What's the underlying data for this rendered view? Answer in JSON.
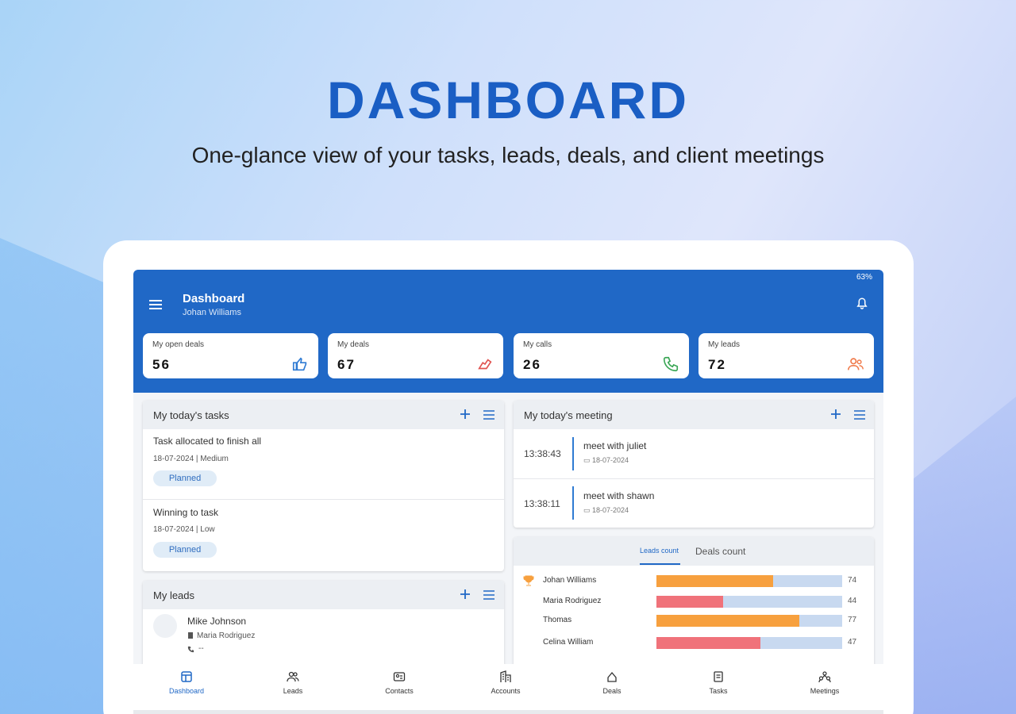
{
  "hero": {
    "title": "DASHBOARD",
    "subtitle": "One-glance view of your tasks, leads, deals, and client meetings"
  },
  "status_bar": {
    "battery": "63%"
  },
  "appbar": {
    "title": "Dashboard",
    "user": "Johan Williams"
  },
  "stats": [
    {
      "label": "My open deals",
      "value": "56",
      "icon": "thumbs-up-icon",
      "color": "#2f7bd3"
    },
    {
      "label": "My deals",
      "value": "67",
      "icon": "handshake-icon",
      "color": "#e0524f"
    },
    {
      "label": "My calls",
      "value": "26",
      "icon": "phone-icon",
      "color": "#3aa655"
    },
    {
      "label": "My leads",
      "value": "72",
      "icon": "users-icon",
      "color": "#f07a4a"
    }
  ],
  "tasks_panel": {
    "title": "My today's tasks",
    "tasks": [
      {
        "name": "Task allocated to finish all",
        "meta": "18-07-2024 | Medium",
        "status": "Planned"
      },
      {
        "name": "Winning to task",
        "meta": "18-07-2024 | Low",
        "status": "Planned"
      }
    ]
  },
  "meetings_panel": {
    "title": "My today's meeting",
    "meetings": [
      {
        "time": "13:38:43",
        "title": "meet with juliet",
        "date": "18-07-2024"
      },
      {
        "time": "13:38:11",
        "title": "meet with shawn",
        "date": "18-07-2024"
      }
    ]
  },
  "leads_panel": {
    "title": "My leads",
    "lead": {
      "name": "Mike Johnson",
      "owner": "Maria Rodriguez",
      "phone": "--"
    }
  },
  "counts_panel": {
    "tabs": [
      "Leads count",
      "Deals count"
    ],
    "active_tab": 0,
    "rows": [
      {
        "name": "Johan Williams",
        "value": 74,
        "fraction": 0.63,
        "color": "#f7a03e",
        "trophy": true
      },
      {
        "name": "Maria Rodriguez",
        "value": 44,
        "fraction": 0.36,
        "color": "#f0727a",
        "trophy": false
      },
      {
        "name": "Thomas",
        "value": 77,
        "fraction": 0.77,
        "color": "#f7a03e",
        "trophy": false
      },
      {
        "name": "Celina William",
        "value": 47,
        "fraction": 0.56,
        "color": "#f0727a",
        "trophy": false
      }
    ]
  },
  "bottom_nav": [
    {
      "label": "Dashboard",
      "icon": "dashboard-icon",
      "active": true
    },
    {
      "label": "Leads",
      "icon": "leads-icon",
      "active": false
    },
    {
      "label": "Contacts",
      "icon": "contacts-icon",
      "active": false
    },
    {
      "label": "Accounts",
      "icon": "accounts-icon",
      "active": false
    },
    {
      "label": "Deals",
      "icon": "deals-icon",
      "active": false
    },
    {
      "label": "Tasks",
      "icon": "tasks-icon",
      "active": false
    },
    {
      "label": "Meetings",
      "icon": "meetings-icon",
      "active": false
    }
  ],
  "colors": {
    "primary": "#2068c6",
    "track": "#c8d9f0"
  }
}
